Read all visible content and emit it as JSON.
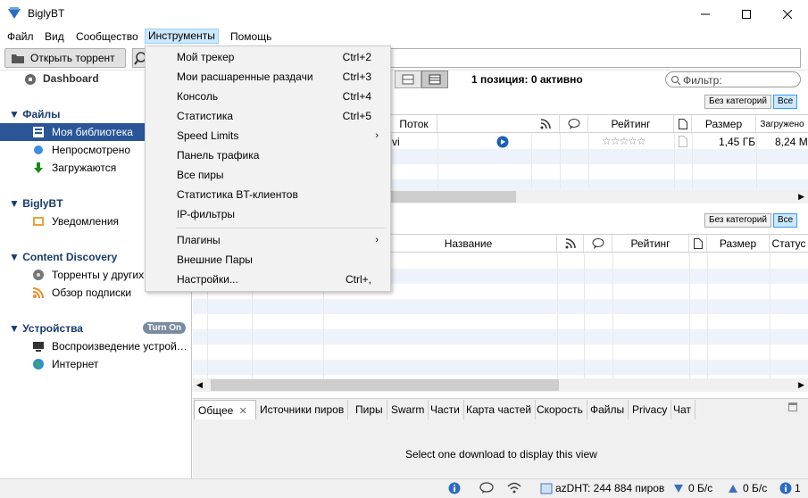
{
  "window": {
    "title": "BiglyBT"
  },
  "menubar": {
    "file": "Файл",
    "view": "Вид",
    "community": "Сообщество",
    "tools": "Инструменты",
    "help": "Помощь"
  },
  "toolbar": {
    "open_torrent": "Открыть торрент"
  },
  "sidebar": {
    "dashboard": "Dashboard",
    "files": {
      "header": "Файлы",
      "items": [
        "Моя библиотека",
        "Непросмотрено",
        "Загружаются"
      ]
    },
    "biglybt": {
      "header": "BiglyBT",
      "items": [
        "Уведомления"
      ]
    },
    "discovery": {
      "header": "Content Discovery",
      "items": [
        "Торренты у других",
        "Обзор подписки"
      ]
    },
    "devices": {
      "header": "Устройства",
      "badge": "Turn On",
      "items": [
        "Воспроизведение устрой…",
        "Интернет"
      ]
    }
  },
  "library": {
    "summary": "1 позиция: 0 активно",
    "filter_placeholder": "Фильтр:",
    "chip_no_category": "Без категорий",
    "chip_all": "Все"
  },
  "top_table": {
    "headers": {
      "stream": "Поток",
      "rating": "Рейтинг",
      "size": "Размер",
      "downloaded": "Загружено"
    },
    "row": {
      "name_tail": "vi",
      "size": "1,45 ГБ",
      "downloaded": "8,24 М"
    }
  },
  "bottom_table": {
    "chip_no_category": "Без категорий",
    "chip_all": "Все",
    "headers": {
      "name": "Название",
      "rating": "Рейтинг",
      "size": "Размер",
      "status": "Статус"
    }
  },
  "tools_menu": {
    "items": [
      {
        "label": "Мой трекер",
        "shortcut": "Ctrl+2"
      },
      {
        "label": "Мои расшаренные раздачи",
        "shortcut": "Ctrl+3"
      },
      {
        "label": "Консоль",
        "shortcut": "Ctrl+4"
      },
      {
        "label": "Статистика",
        "shortcut": "Ctrl+5"
      },
      {
        "label": "Speed Limits",
        "submenu": "›"
      },
      {
        "label": "Панель трафика"
      },
      {
        "label": "Все пиры"
      },
      {
        "label": "Статистика BT-клиентов"
      },
      {
        "label": "IP-фильтры"
      },
      {
        "label": "Плагины",
        "submenu": "›"
      },
      {
        "label": "Внешние Пары"
      },
      {
        "label": "Настройки...",
        "shortcut": "Ctrl+,"
      }
    ]
  },
  "detail_tabs": [
    "Общее",
    "Источники пиров",
    "Пиры",
    "Swarm",
    "Части",
    "Карта частей",
    "Скорость",
    "Файлы",
    "Privacy",
    "Чат"
  ],
  "detail": {
    "empty_message": "Select one download to display this view"
  },
  "statusbar": {
    "dht": "azDHT: 244 884 пиров",
    "down": "0 Б/с",
    "up": "0 Б/с",
    "alerts": "1"
  },
  "colors": {
    "selection": "#2a5698",
    "menu_highlight": "#cce8ff",
    "header_text": "#1a3b6e"
  }
}
